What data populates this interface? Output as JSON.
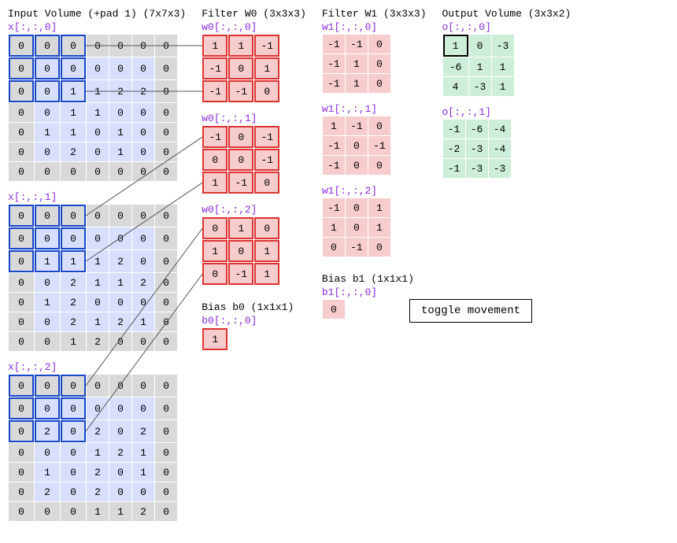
{
  "input": {
    "title": "Input Volume (+pad 1) (7x7x3)",
    "sliceLabels": [
      "x[:,:,0]",
      "x[:,:,1]",
      "x[:,:,2]"
    ],
    "pad": 1,
    "rf": {
      "row": 0,
      "col": 0,
      "size": 3
    },
    "slices": [
      [
        [
          0,
          0,
          0,
          0,
          0,
          0,
          0
        ],
        [
          0,
          0,
          0,
          0,
          0,
          0,
          0
        ],
        [
          0,
          0,
          1,
          1,
          2,
          2,
          0
        ],
        [
          0,
          0,
          1,
          1,
          0,
          0,
          0
        ],
        [
          0,
          1,
          1,
          0,
          1,
          0,
          0
        ],
        [
          0,
          0,
          2,
          0,
          1,
          0,
          0
        ],
        [
          0,
          0,
          0,
          0,
          0,
          0,
          0
        ]
      ],
      [
        [
          0,
          0,
          0,
          0,
          0,
          0,
          0
        ],
        [
          0,
          0,
          0,
          0,
          0,
          0,
          0
        ],
        [
          0,
          1,
          1,
          1,
          2,
          0,
          0
        ],
        [
          0,
          0,
          2,
          1,
          1,
          2,
          0
        ],
        [
          0,
          1,
          2,
          0,
          0,
          0,
          0
        ],
        [
          0,
          0,
          2,
          1,
          2,
          1,
          0
        ],
        [
          0,
          0,
          1,
          2,
          0,
          0,
          0
        ]
      ],
      [
        [
          0,
          0,
          0,
          0,
          0,
          0,
          0
        ],
        [
          0,
          0,
          0,
          0,
          0,
          0,
          0
        ],
        [
          0,
          2,
          0,
          2,
          0,
          2,
          0
        ],
        [
          0,
          0,
          0,
          1,
          2,
          1,
          0
        ],
        [
          0,
          1,
          0,
          2,
          0,
          1,
          0
        ],
        [
          0,
          2,
          0,
          2,
          0,
          0,
          0
        ],
        [
          0,
          0,
          0,
          1,
          1,
          2,
          0
        ]
      ]
    ]
  },
  "filterW0": {
    "title": "Filter W0 (3x3x3)",
    "sliceLabels": [
      "w0[:,:,0]",
      "w0[:,:,1]",
      "w0[:,:,2]"
    ],
    "slices": [
      [
        [
          1,
          1,
          -1
        ],
        [
          -1,
          0,
          1
        ],
        [
          -1,
          -1,
          0
        ]
      ],
      [
        [
          -1,
          0,
          -1
        ],
        [
          0,
          0,
          -1
        ],
        [
          1,
          -1,
          0
        ]
      ],
      [
        [
          0,
          1,
          0
        ],
        [
          1,
          0,
          1
        ],
        [
          0,
          -1,
          1
        ]
      ]
    ]
  },
  "filterW1": {
    "title": "Filter W1 (3x3x3)",
    "sliceLabels": [
      "w1[:,:,0]",
      "w1[:,:,1]",
      "w1[:,:,2]"
    ],
    "slices": [
      [
        [
          -1,
          -1,
          0
        ],
        [
          -1,
          1,
          0
        ],
        [
          -1,
          1,
          0
        ]
      ],
      [
        [
          1,
          -1,
          0
        ],
        [
          -1,
          0,
          -1
        ],
        [
          -1,
          0,
          0
        ]
      ],
      [
        [
          -1,
          0,
          1
        ],
        [
          1,
          0,
          1
        ],
        [
          0,
          -1,
          0
        ]
      ]
    ]
  },
  "output": {
    "title": "Output Volume (3x3x2)",
    "sliceLabels": [
      "o[:,:,0]",
      "o[:,:,1]"
    ],
    "highlight": {
      "slice": 0,
      "row": 0,
      "col": 0
    },
    "slices": [
      [
        [
          1,
          0,
          -3
        ],
        [
          -6,
          1,
          1
        ],
        [
          4,
          -3,
          1
        ]
      ],
      [
        [
          -1,
          -6,
          -4
        ],
        [
          -2,
          -3,
          -4
        ],
        [
          -1,
          -3,
          -3
        ]
      ]
    ]
  },
  "biasB0": {
    "title": "Bias b0 (1x1x1)",
    "label": "b0[:,:,0]",
    "value": 1
  },
  "biasB1": {
    "title": "Bias b1 (1x1x1)",
    "label": "b1[:,:,0]",
    "value": 0
  },
  "toggleLabel": "toggle movement"
}
